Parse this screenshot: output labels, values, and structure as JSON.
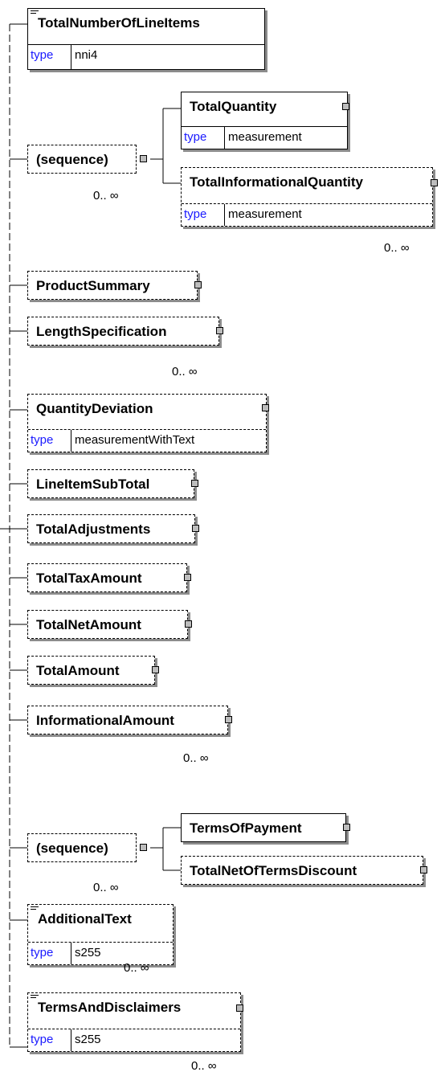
{
  "elements": {
    "total_number_of_line_items": {
      "name": "TotalNumberOfLineItems",
      "type_label": "type",
      "type_value": "nni4"
    },
    "sequence_1": {
      "label": "(sequence)",
      "cardinality": "0.. ∞"
    },
    "total_quantity": {
      "name": "TotalQuantity",
      "type_label": "type",
      "type_value": "measurement"
    },
    "total_informational_quantity": {
      "name": "TotalInformationalQuantity",
      "type_label": "type",
      "type_value": "measurement",
      "cardinality": "0.. ∞"
    },
    "product_summary": {
      "name": "ProductSummary"
    },
    "length_specification": {
      "name": "LengthSpecification",
      "cardinality": "0.. ∞"
    },
    "quantity_deviation": {
      "name": "QuantityDeviation",
      "type_label": "type",
      "type_value": "measurementWithText"
    },
    "line_item_sub_total": {
      "name": "LineItemSubTotal"
    },
    "total_adjustments": {
      "name": "TotalAdjustments"
    },
    "total_tax_amount": {
      "name": "TotalTaxAmount"
    },
    "total_net_amount": {
      "name": "TotalNetAmount"
    },
    "total_amount": {
      "name": "TotalAmount"
    },
    "informational_amount": {
      "name": "InformationalAmount",
      "cardinality": "0.. ∞"
    },
    "sequence_2": {
      "label": "(sequence)",
      "cardinality": "0.. ∞"
    },
    "terms_of_payment": {
      "name": "TermsOfPayment"
    },
    "total_net_of_terms_discount": {
      "name": "TotalNetOfTermsDiscount"
    },
    "additional_text": {
      "name": "AdditionalText",
      "type_label": "type",
      "type_value": "s255",
      "cardinality": "0.. ∞"
    },
    "terms_and_disclaimers": {
      "name": "TermsAndDisclaimers",
      "type_label": "type",
      "type_value": "s255",
      "cardinality": "0.. ∞"
    }
  },
  "colors": {
    "type_keyword": "#1a1aff",
    "expander_fill": "#bdbdbd",
    "shadow": "#8c8c8c"
  }
}
